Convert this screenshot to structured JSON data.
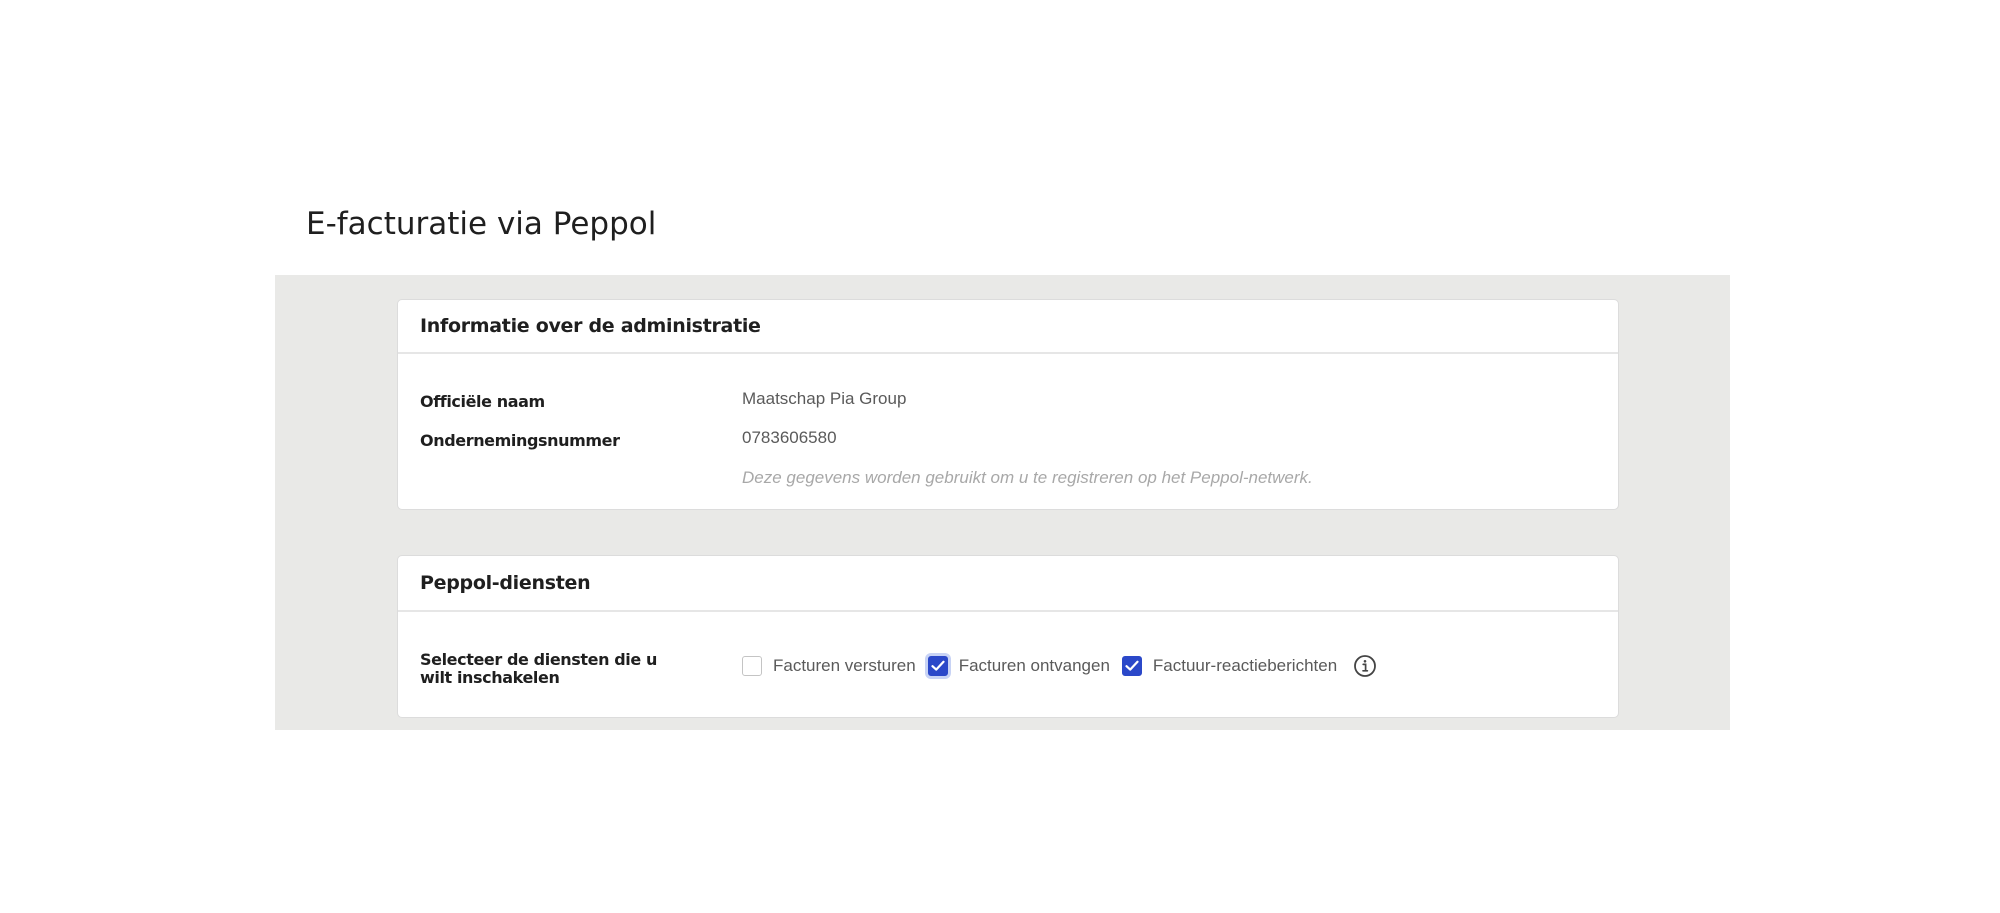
{
  "page": {
    "title": "E-facturatie via Peppol"
  },
  "admin_card": {
    "title": "Informatie over de administratie",
    "fields": [
      {
        "label": "Officiële naam",
        "value": "Maatschap Pia Group"
      },
      {
        "label": "Ondernemingsnummer",
        "value": "0783606580"
      }
    ],
    "hint": "Deze gegevens worden gebruikt om u te registreren op het Peppol-netwerk."
  },
  "services_card": {
    "title": "Peppol-diensten",
    "label": "Selecteer de diensten die u wilt inschakelen",
    "options": [
      {
        "label": "Facturen versturen",
        "checked": false
      },
      {
        "label": "Facturen ontvangen",
        "checked": true
      },
      {
        "label": "Factuur-reactieberichten",
        "checked": true
      }
    ],
    "info_icon": "info-circle-icon"
  },
  "colors": {
    "accent": "#2b48c9",
    "background_band": "#e9e9e7",
    "text_primary": "#1f1f1f",
    "text_secondary": "#5a5a5a",
    "hint": "#a8a8a8"
  }
}
